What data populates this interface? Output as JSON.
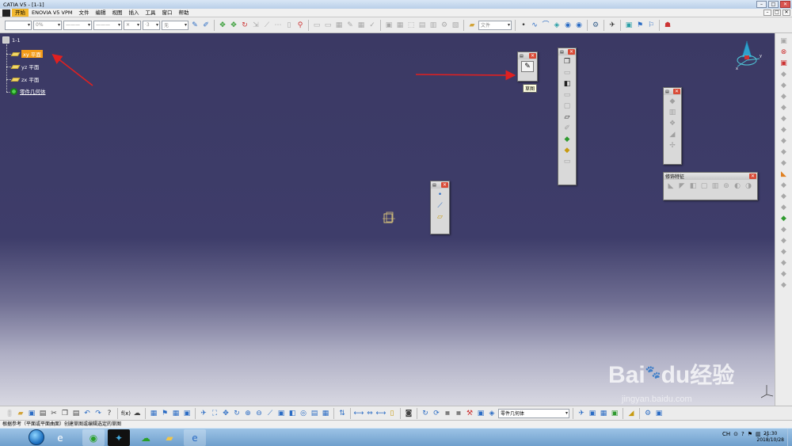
{
  "window": {
    "title": "CATIA V5 - [1-1]",
    "controls": {
      "minimize": "–",
      "maximize": "□",
      "close": "✕"
    }
  },
  "menubar": {
    "items": [
      "开始",
      "ENOVIA V5 VPM",
      "文件",
      "编辑",
      "视图",
      "插入",
      "工具",
      "窗口",
      "帮助"
    ]
  },
  "toolbar_top": {
    "combo_color": "",
    "combo_opacity": "0%",
    "combo_line1": "———",
    "combo_line2": "———",
    "combo_symbol": "✕",
    "combo_layer": "·3",
    "combo_none": "无",
    "combo_file": "文件"
  },
  "tree": {
    "root": "1-1",
    "items": [
      {
        "label": "xy 平面",
        "selected": true
      },
      {
        "label": "yz 平面",
        "selected": false
      },
      {
        "label": "zx 平面",
        "selected": false
      },
      {
        "label": "零件几何体",
        "selected": false
      }
    ]
  },
  "floating": {
    "sketch_tooltip": "草图",
    "modify_title": "修饰特征"
  },
  "bottom_toolbar": {
    "body_combo": "零件几何体"
  },
  "statusbar": {
    "text": "根据参考（平面或平面曲面）创建草图或编辑选定的草图"
  },
  "clock": {
    "time": "21:30",
    "date": "2018/10/28"
  },
  "tray": {
    "lang": "CH"
  },
  "watermark": {
    "brand": "Bai",
    "brand2": "du",
    "cn": "经验",
    "url": "jingyan.baidu.com"
  },
  "colors": {
    "canvas_top": "#3b3964",
    "highlight": "#f49b18",
    "arrow": "#e02020"
  }
}
